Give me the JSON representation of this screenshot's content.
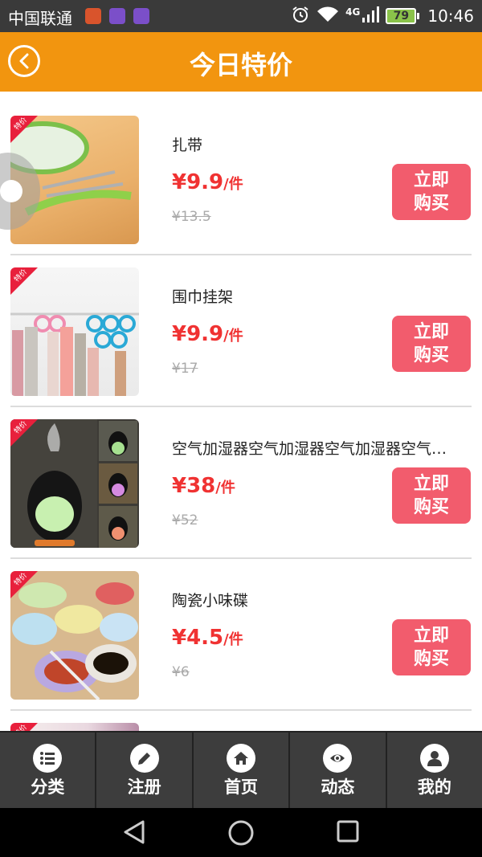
{
  "status_bar": {
    "carrier": "中国联通",
    "network": "4G",
    "battery": "79",
    "time": "10:46"
  },
  "header": {
    "title": "今日特价"
  },
  "tag_label": "特价",
  "products": [
    {
      "name": "扎带",
      "price": "¥9.9",
      "unit": "/件",
      "old_price": "¥13.5",
      "buy_label": "立即购买"
    },
    {
      "name": "围巾挂架",
      "price": "¥9.9",
      "unit": "/件",
      "old_price": "¥17",
      "buy_label": "立即购买"
    },
    {
      "name": "空气加湿器空气加湿器空气加湿器空气加湿器",
      "price": "¥38",
      "unit": "/件",
      "old_price": "¥52",
      "buy_label": "立即购买"
    },
    {
      "name": "陶瓷小味碟",
      "price": "¥4.5",
      "unit": "/件",
      "old_price": "¥6",
      "buy_label": "立即购买"
    }
  ],
  "bottom_nav": [
    {
      "label": "分类",
      "icon": "list-icon"
    },
    {
      "label": "注册",
      "icon": "pencil-icon"
    },
    {
      "label": "首页",
      "icon": "home-icon"
    },
    {
      "label": "动态",
      "icon": "eye-icon"
    },
    {
      "label": "我的",
      "icon": "user-icon"
    }
  ],
  "colors": {
    "header": "#f2950f",
    "price": "#f03232",
    "buy_button": "#f25c6d",
    "nav_bg": "#3d3d3d"
  }
}
